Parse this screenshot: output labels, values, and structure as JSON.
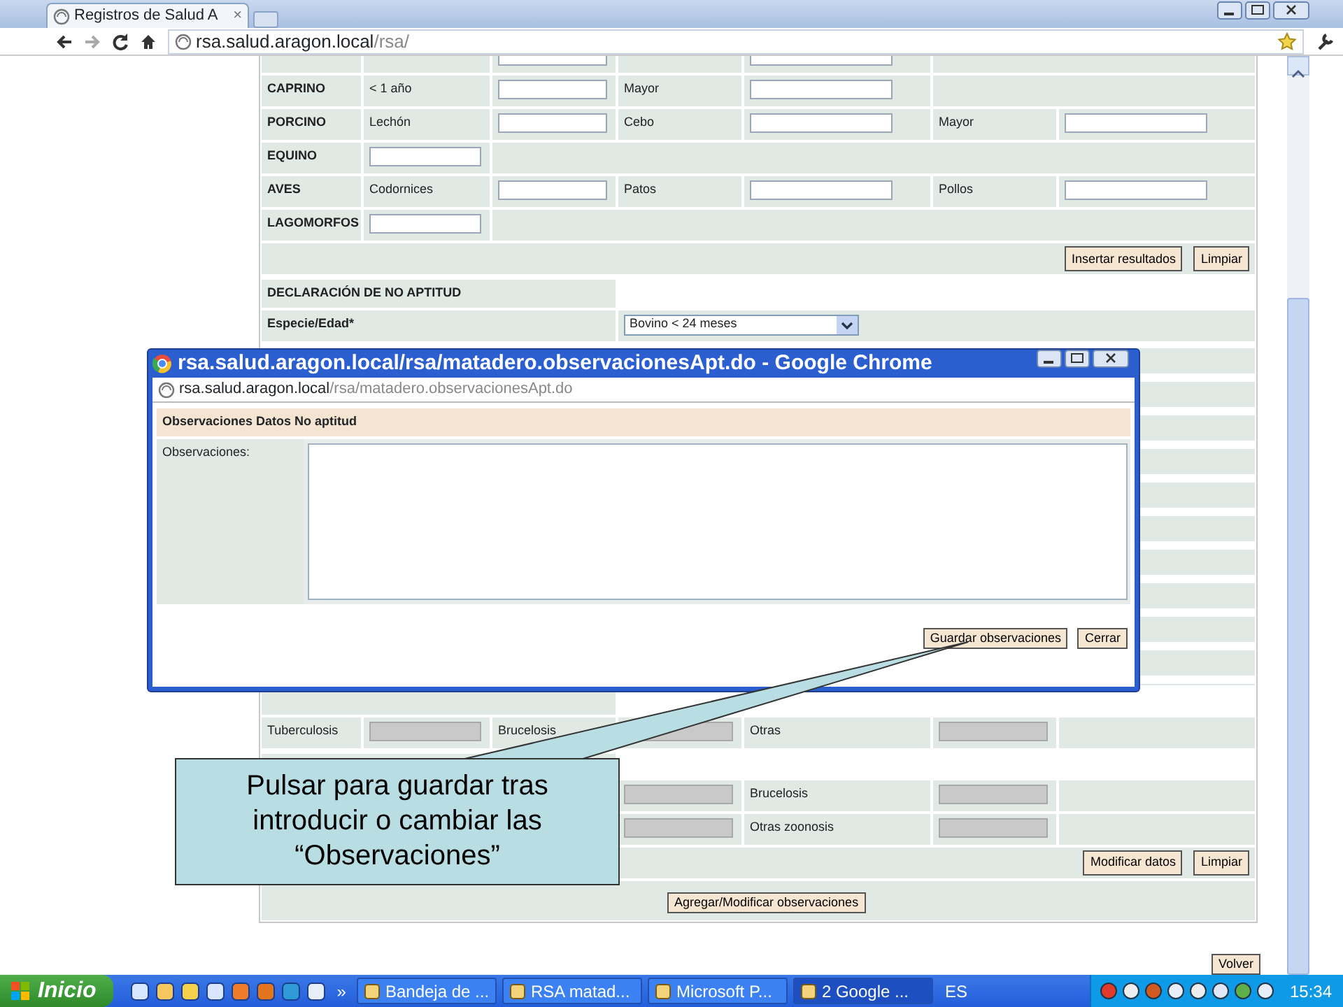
{
  "browser": {
    "tab": {
      "title": "Registros de Salud A",
      "close": "×"
    },
    "address": {
      "host": "rsa.salud.aragon.local",
      "path": "/rsa/"
    }
  },
  "form": {
    "rows": [
      {
        "kind": "top",
        "cells": [
          {
            "disabled": false
          },
          {
            "disabled": false
          }
        ]
      },
      {
        "kind": "fields",
        "cells": [
          {
            "kind": "bold_label",
            "text": "CAPRINO"
          },
          {
            "kind": "label",
            "text": "< 1 año"
          },
          {
            "kind": "input",
            "disabled": false
          },
          {
            "kind": "label",
            "text": "Mayor"
          },
          {
            "kind": "input",
            "disabled": false
          }
        ]
      },
      {
        "kind": "fields",
        "cells": [
          {
            "kind": "bold_label",
            "text": "PORCINO"
          },
          {
            "kind": "label",
            "text": "Lechón"
          },
          {
            "kind": "input",
            "disabled": false
          },
          {
            "kind": "label",
            "text": "Cebo"
          },
          {
            "kind": "input",
            "disabled": false
          },
          {
            "kind": "label",
            "text": "Mayor"
          },
          {
            "kind": "input",
            "disabled": false
          }
        ]
      },
      {
        "kind": "fields",
        "cells": [
          {
            "kind": "bold_label",
            "text": "EQUINO"
          },
          {
            "kind": "input",
            "disabled": false
          }
        ]
      },
      {
        "kind": "fields",
        "cells": [
          {
            "kind": "bold_label",
            "text": "AVES"
          },
          {
            "kind": "label",
            "text": "Codornices"
          },
          {
            "kind": "input",
            "disabled": false
          },
          {
            "kind": "label",
            "text": "Patos"
          },
          {
            "kind": "input",
            "disabled": false
          },
          {
            "kind": "label",
            "text": "Pollos"
          },
          {
            "kind": "input",
            "disabled": false
          }
        ]
      },
      {
        "kind": "fields",
        "cells": [
          {
            "kind": "bold_label",
            "text": "LAGOMORFOS"
          },
          {
            "kind": "input",
            "disabled": false
          }
        ]
      },
      {
        "kind": "buttons",
        "buttons": [
          "Insertar resultados",
          "Limpiar"
        ]
      },
      {
        "kind": "header",
        "text": "DECLARACIÓN DE NO APTITUD"
      },
      {
        "kind": "select",
        "label": "Especie/Edad*",
        "value": "Bovino < 24 meses"
      },
      {
        "kind": "covered"
      },
      {
        "kind": "header"
      },
      {
        "kind": "fields",
        "cells": [
          {
            "kind": "label",
            "text": "Tuberculosis"
          },
          {
            "kind": "input",
            "disabled": true
          },
          {
            "kind": "label",
            "text": "Brucelosis"
          },
          {
            "kind": "input",
            "disabled": true
          },
          {
            "kind": "label",
            "text": "Otras"
          },
          {
            "kind": "input",
            "disabled": true
          }
        ]
      },
      {
        "kind": "header"
      },
      {
        "kind": "partial",
        "cells": [
          {
            "kind": "input",
            "disabled": true
          },
          {
            "kind": "label",
            "text": "Brucelosis"
          },
          {
            "kind": "input",
            "disabled": true
          }
        ]
      },
      {
        "kind": "partial",
        "cells": [
          {
            "kind": "input",
            "disabled": true
          },
          {
            "kind": "label",
            "text": "Otras zoonosis"
          },
          {
            "kind": "input",
            "disabled": true
          }
        ]
      },
      {
        "kind": "buttons",
        "buttons": [
          "Modificar datos",
          "Limpiar"
        ]
      },
      {
        "kind": "wide_button",
        "text": "Agregar/Modificar observaciones"
      }
    ]
  },
  "footer_button": "Volver",
  "popup": {
    "title": "rsa.salud.aragon.local/rsa/matadero.observacionesApt.do - Google Chrome",
    "address": {
      "host": "rsa.salud.aragon.local",
      "path": "/rsa/matadero.observacionesApt.do"
    },
    "section_title": "Observaciones Datos No aptitud",
    "field_label": "Observaciones:",
    "buttons": [
      "Guardar observaciones",
      "Cerrar"
    ]
  },
  "callout": {
    "text": "Pulsar para guardar tras introducir o cambiar las “Observaciones”"
  },
  "taskbar": {
    "start": "Inicio",
    "more": "»",
    "tasks": [
      {
        "label": "Bandeja de ...",
        "selected": false
      },
      {
        "label": "RSA matad...",
        "selected": false
      },
      {
        "label": "Microsoft P...",
        "selected": false
      },
      {
        "label": "2 Google ...",
        "selected": true
      }
    ],
    "language": "ES",
    "clock": "15:34"
  }
}
